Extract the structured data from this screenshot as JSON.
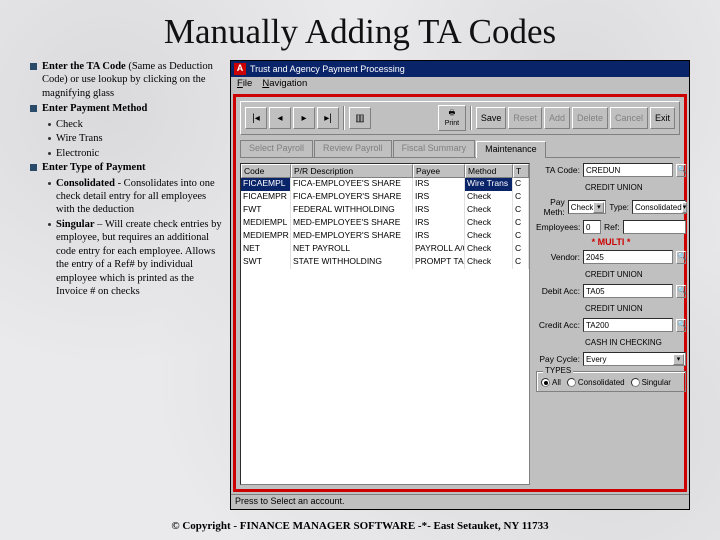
{
  "title": "Manually Adding TA Codes",
  "bullets": [
    {
      "bold": "Enter the TA Code",
      "rest": " (Same as Deduction Code) or use lookup by clicking on the magnifying glass"
    },
    {
      "bold": "Enter Payment Method",
      "sub": [
        "Check",
        "Wire Trans",
        "Electronic"
      ]
    },
    {
      "bold": "Enter Type of Payment",
      "sub": [
        {
          "bold": "Consolidated",
          "rest": " - Consolidates into one check detail entry for all employees with the deduction"
        },
        {
          "bold": "Singular",
          "rest": " – Will create check entries by employee, but requires an additional code entry for each employee. Allows the entry of a Ref# by individual employee which is printed as the Invoice # on checks"
        }
      ]
    }
  ],
  "window": {
    "title": "Trust and Agency Payment Processing",
    "menu": [
      "File",
      "Navigation"
    ],
    "toolbar": {
      "print": "Print",
      "save": "Save",
      "reset": "Reset",
      "add": "Add",
      "delete": "Delete",
      "cancel": "Cancel",
      "exit": "Exit"
    },
    "tabs": [
      "Select Payroll",
      "Review Payroll",
      "Fiscal Summary",
      "Maintenance"
    ],
    "table": {
      "headers": [
        "Code",
        "P/R Description",
        "Payee",
        "Method",
        "T"
      ],
      "rows": [
        {
          "sel": true,
          "c": [
            "FICAEMPL",
            "FICA-EMPLOYEE'S SHARE",
            "IRS",
            "Wire Trans",
            "C"
          ]
        },
        {
          "sel": false,
          "c": [
            "FICAEMPR",
            "FICA-EMPLOYER'S SHARE",
            "IRS",
            "Check",
            "C"
          ]
        },
        {
          "sel": false,
          "c": [
            "FWT",
            "FEDERAL WITHHOLDING",
            "IRS",
            "Check",
            "C"
          ]
        },
        {
          "sel": false,
          "c": [
            "MEDIEMPL",
            "MED-EMPLOYEE'S SHARE",
            "IRS",
            "Check",
            "C"
          ]
        },
        {
          "sel": false,
          "c": [
            "MEDIEMPR",
            "MED-EMPLOYER'S SHARE",
            "IRS",
            "Check",
            "C"
          ]
        },
        {
          "sel": false,
          "c": [
            "NET",
            "NET PAYROLL",
            "PAYROLL A/C",
            "Check",
            "C"
          ]
        },
        {
          "sel": false,
          "c": [
            "SWT",
            "STATE WITHHOLDING",
            "PROMPT TAX",
            "Check",
            "C"
          ]
        }
      ]
    },
    "form": {
      "labels": {
        "ta_code": "TA Code:",
        "pay_meth": "Pay Meth:",
        "type": "Type:",
        "employees": "Employees:",
        "ref": "Ref:",
        "vendor": "Vendor:",
        "debit": "Debit Acc:",
        "credit": "Credit Acc:",
        "pay_cycle": "Pay Cycle:"
      },
      "values": {
        "ta_code": "CREDUN",
        "ta_desc": "CREDIT UNION",
        "pay_meth": "Check",
        "type": "Consolidated",
        "employees": "0",
        "vendor": "2045",
        "vendor_desc": "CREDIT UNION",
        "debit": "TA05",
        "debit_desc": "CREDIT UNION",
        "credit": "TA200",
        "credit_desc": "CASH IN CHECKING",
        "pay_cycle": "Every"
      },
      "multi": "* MULTI *",
      "types": {
        "legend": "TYPES",
        "opts": [
          "All",
          "Consolidated",
          "Singular"
        ]
      }
    },
    "status": "Press to Select an account."
  },
  "footer": "© Copyright - FINANCE MANAGER SOFTWARE -*- East Setauket, NY 11733"
}
